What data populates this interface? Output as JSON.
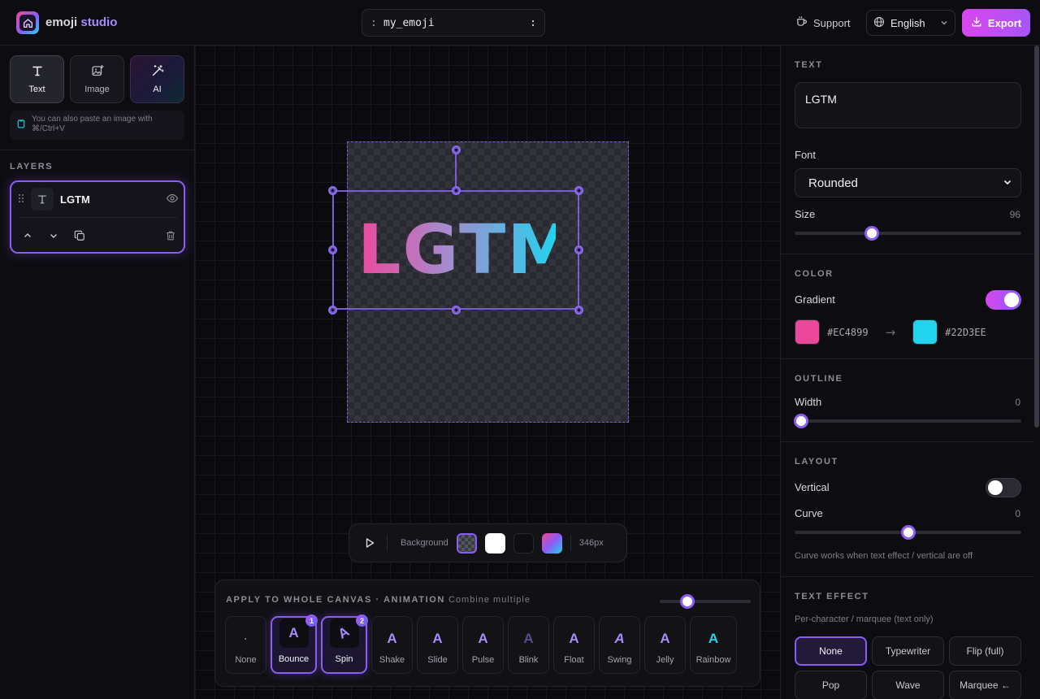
{
  "header": {
    "brand_main": "emoji",
    "brand_accent": "studio",
    "filename_prefix": ":",
    "filename": "my_emoji",
    "filename_suffix": ":",
    "support_label": "Support",
    "language": "English",
    "export_label": "Export"
  },
  "left_panel": {
    "tools": [
      {
        "label": "Text",
        "icon": "text-icon",
        "active": true
      },
      {
        "label": "Image",
        "icon": "image-add-icon",
        "active": false
      },
      {
        "label": "AI",
        "icon": "magic-wand-icon",
        "active": false
      }
    ],
    "paste_hint": "You can also paste an image with ⌘/Ctrl+V",
    "layers_title": "LAYERS",
    "layers": [
      {
        "name": "LGTM",
        "type": "text",
        "visible": true
      }
    ]
  },
  "canvas": {
    "text": "LGTM",
    "gradient_from": "#EC4899",
    "gradient_to": "#22D3EE",
    "background_label": "Background",
    "background_options": [
      "transparent",
      "white",
      "black",
      "gradient"
    ],
    "background_selected": "transparent",
    "size_label": "346px"
  },
  "animation": {
    "title": "APPLY TO WHOLE CANVAS · ANIMATION",
    "subtitle": "Combine multiple",
    "speed_value": 0.3,
    "items": [
      {
        "label": "None",
        "glyph": "·",
        "active": false
      },
      {
        "label": "Bounce",
        "glyph": "A",
        "active": true,
        "order": "1"
      },
      {
        "label": "Spin",
        "glyph": "A",
        "active": true,
        "order": "2"
      },
      {
        "label": "Shake",
        "glyph": "A",
        "active": false
      },
      {
        "label": "Slide",
        "glyph": "A",
        "active": false
      },
      {
        "label": "Pulse",
        "glyph": "A",
        "active": false
      },
      {
        "label": "Blink",
        "glyph": "A",
        "active": false
      },
      {
        "label": "Float",
        "glyph": "A",
        "active": false
      },
      {
        "label": "Swing",
        "glyph": "A",
        "active": false
      },
      {
        "label": "Jelly",
        "glyph": "A",
        "active": false
      },
      {
        "label": "Rainbow",
        "glyph": "A",
        "active": false
      }
    ]
  },
  "right_panel": {
    "text_title": "TEXT",
    "text_value": "LGTM",
    "font_label": "Font",
    "font_value": "Rounded",
    "size_label": "Size",
    "size_value": "96",
    "size_fraction": 0.34,
    "color_title": "COLOR",
    "gradient_label": "Gradient",
    "gradient_on": true,
    "color_from": "#EC4899",
    "color_to": "#22D3EE",
    "outline_title": "OUTLINE",
    "width_label": "Width",
    "width_value": "0",
    "width_fraction": 0,
    "layout_title": "LAYOUT",
    "vertical_label": "Vertical",
    "vertical_on": false,
    "curve_label": "Curve",
    "curve_value": "0",
    "curve_fraction": 0.5,
    "curve_hint": "Curve works when text effect / vertical are off",
    "effect_title": "TEXT EFFECT",
    "effect_hint": "Per-character / marquee (text only)",
    "effects": [
      {
        "label": "None",
        "active": true
      },
      {
        "label": "Typewriter",
        "active": false
      },
      {
        "label": "Flip (full)",
        "active": false
      },
      {
        "label": "Pop",
        "active": false
      },
      {
        "label": "Wave",
        "active": false
      },
      {
        "label": "Marquee ←",
        "active": false
      }
    ]
  },
  "colors": {
    "accent": "#8B5CF6",
    "export_from": "#D946EF",
    "export_to": "#A855F7"
  }
}
